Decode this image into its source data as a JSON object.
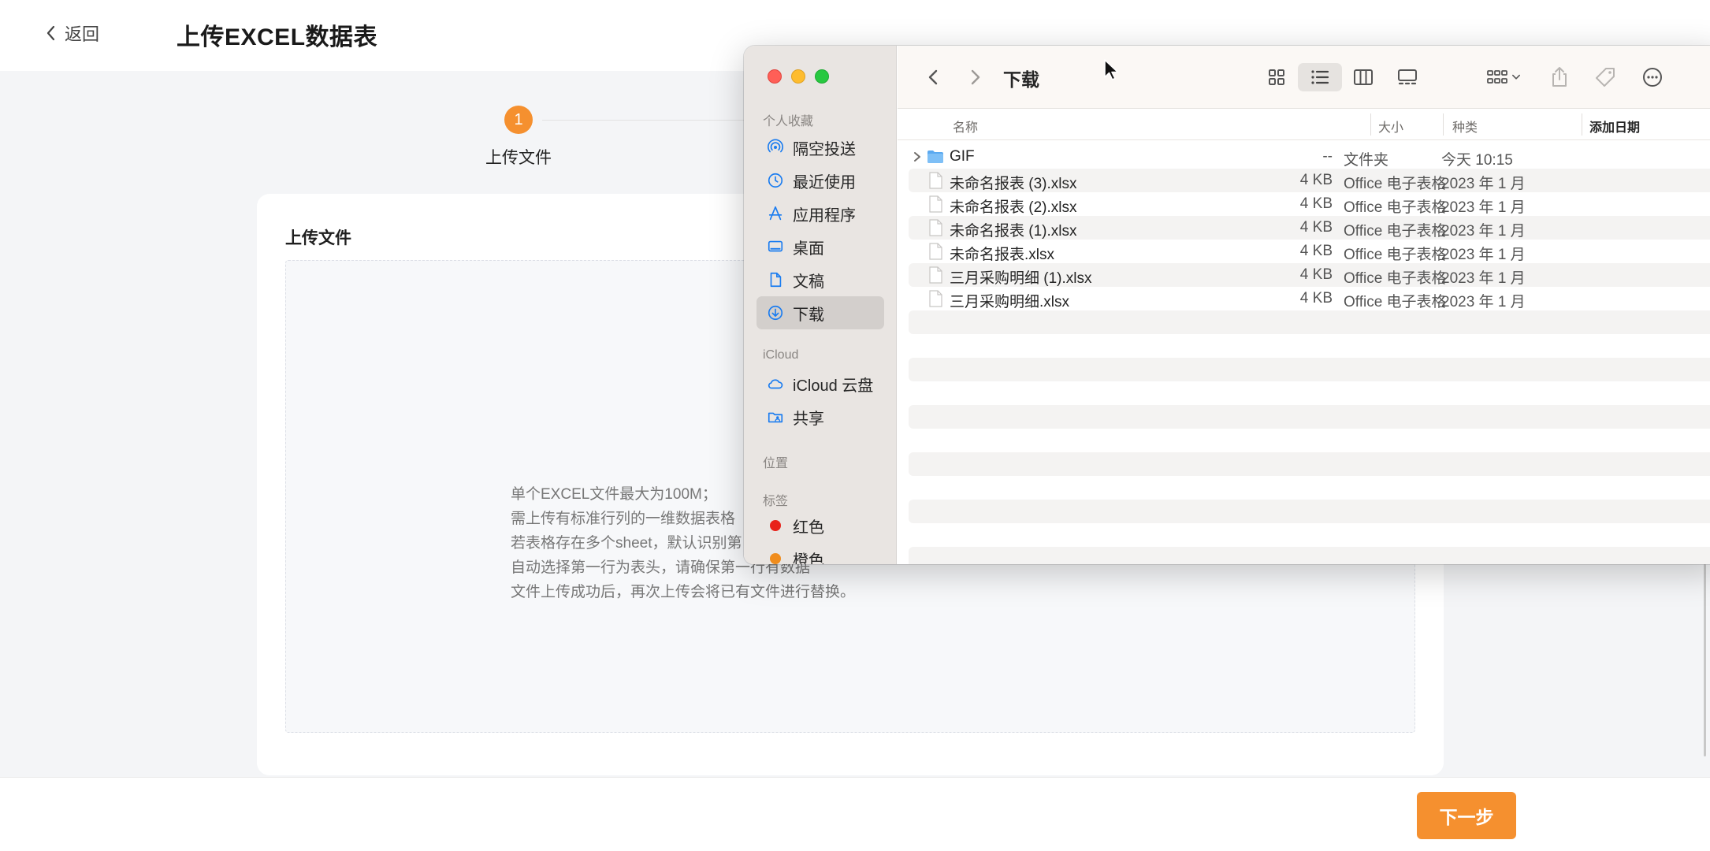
{
  "app": {
    "back_label": "返回",
    "page_title": "上传EXCEL数据表",
    "steps": [
      {
        "number": "1",
        "label": "上传文件"
      }
    ],
    "card_title": "上传文件",
    "hints": [
      "单个EXCEL文件最大为100M；",
      "需上传有标准行列的一维数据表格",
      "若表格存在多个sheet，默认识别第",
      "自动选择第一行为表头，请确保第一行有数据",
      "文件上传成功后，再次上传会将已有文件进行替换。"
    ],
    "next_label": "下一步",
    "accent_color": "#f5902f"
  },
  "finder": {
    "current_folder": "下载",
    "sidebar": {
      "favorites_header": "个人收藏",
      "favorites": [
        {
          "label": "隔空投送",
          "icon": "airdrop-icon"
        },
        {
          "label": "最近使用",
          "icon": "clock-icon"
        },
        {
          "label": "应用程序",
          "icon": "applications-icon"
        },
        {
          "label": "桌面",
          "icon": "desktop-icon"
        },
        {
          "label": "文稿",
          "icon": "document-icon"
        },
        {
          "label": "下载",
          "icon": "download-icon"
        }
      ],
      "icloud_header": "iCloud",
      "icloud": [
        {
          "label": "iCloud 云盘",
          "icon": "cloud-icon"
        },
        {
          "label": "共享",
          "icon": "shared-folder-icon"
        }
      ],
      "locations_header": "位置",
      "tags_header": "标签",
      "tags": [
        {
          "label": "红色",
          "color": "#e8221a"
        },
        {
          "label": "橙色",
          "color": "#f08c1c"
        }
      ]
    },
    "columns": {
      "name": "名称",
      "size": "大小",
      "kind": "种类",
      "date": "添加日期"
    },
    "files": [
      {
        "name": "GIF",
        "size": "--",
        "kind": "文件夹",
        "date": "今天 10:15",
        "is_folder": true
      },
      {
        "name": "未命名报表 (3).xlsx",
        "size": "4 KB",
        "kind": "Office 电子表格",
        "date": "2023 年 1 月"
      },
      {
        "name": "未命名报表 (2).xlsx",
        "size": "4 KB",
        "kind": "Office 电子表格",
        "date": "2023 年 1 月"
      },
      {
        "name": "未命名报表 (1).xlsx",
        "size": "4 KB",
        "kind": "Office 电子表格",
        "date": "2023 年 1 月"
      },
      {
        "name": "未命名报表.xlsx",
        "size": "4 KB",
        "kind": "Office 电子表格",
        "date": "2023 年 1 月"
      },
      {
        "name": "三月采购明细 (1).xlsx",
        "size": "4 KB",
        "kind": "Office 电子表格",
        "date": "2023 年 1 月"
      },
      {
        "name": "三月采购明细.xlsx",
        "size": "4 KB",
        "kind": "Office 电子表格",
        "date": "2023 年 1 月"
      }
    ]
  }
}
